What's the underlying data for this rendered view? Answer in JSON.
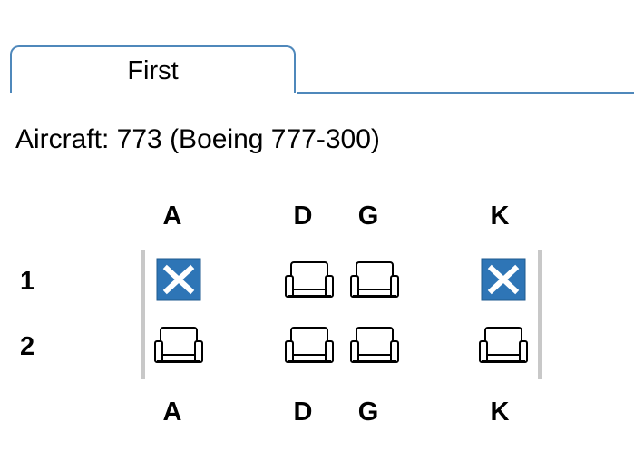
{
  "tabs": [
    {
      "label": "First",
      "active": true
    }
  ],
  "aircraft_line": "Aircraft: 773 (Boeing 777-300)",
  "seatmap": {
    "columns": [
      "A",
      "D",
      "G",
      "K"
    ],
    "rows": [
      {
        "row": "1",
        "seats": [
          {
            "col": "A",
            "status": "occupied"
          },
          {
            "col": "D",
            "status": "available"
          },
          {
            "col": "G",
            "status": "available"
          },
          {
            "col": "K",
            "status": "occupied"
          }
        ]
      },
      {
        "row": "2",
        "seats": [
          {
            "col": "A",
            "status": "available"
          },
          {
            "col": "D",
            "status": "available"
          },
          {
            "col": "G",
            "status": "available"
          },
          {
            "col": "K",
            "status": "available"
          }
        ]
      }
    ]
  },
  "colors": {
    "tab_border": "#4f88bb",
    "occupied_seat": "#2e75b6",
    "bulkhead": "#c8c8c8"
  },
  "icons": {
    "available": "seat-available-icon",
    "occupied": "seat-occupied-icon"
  }
}
